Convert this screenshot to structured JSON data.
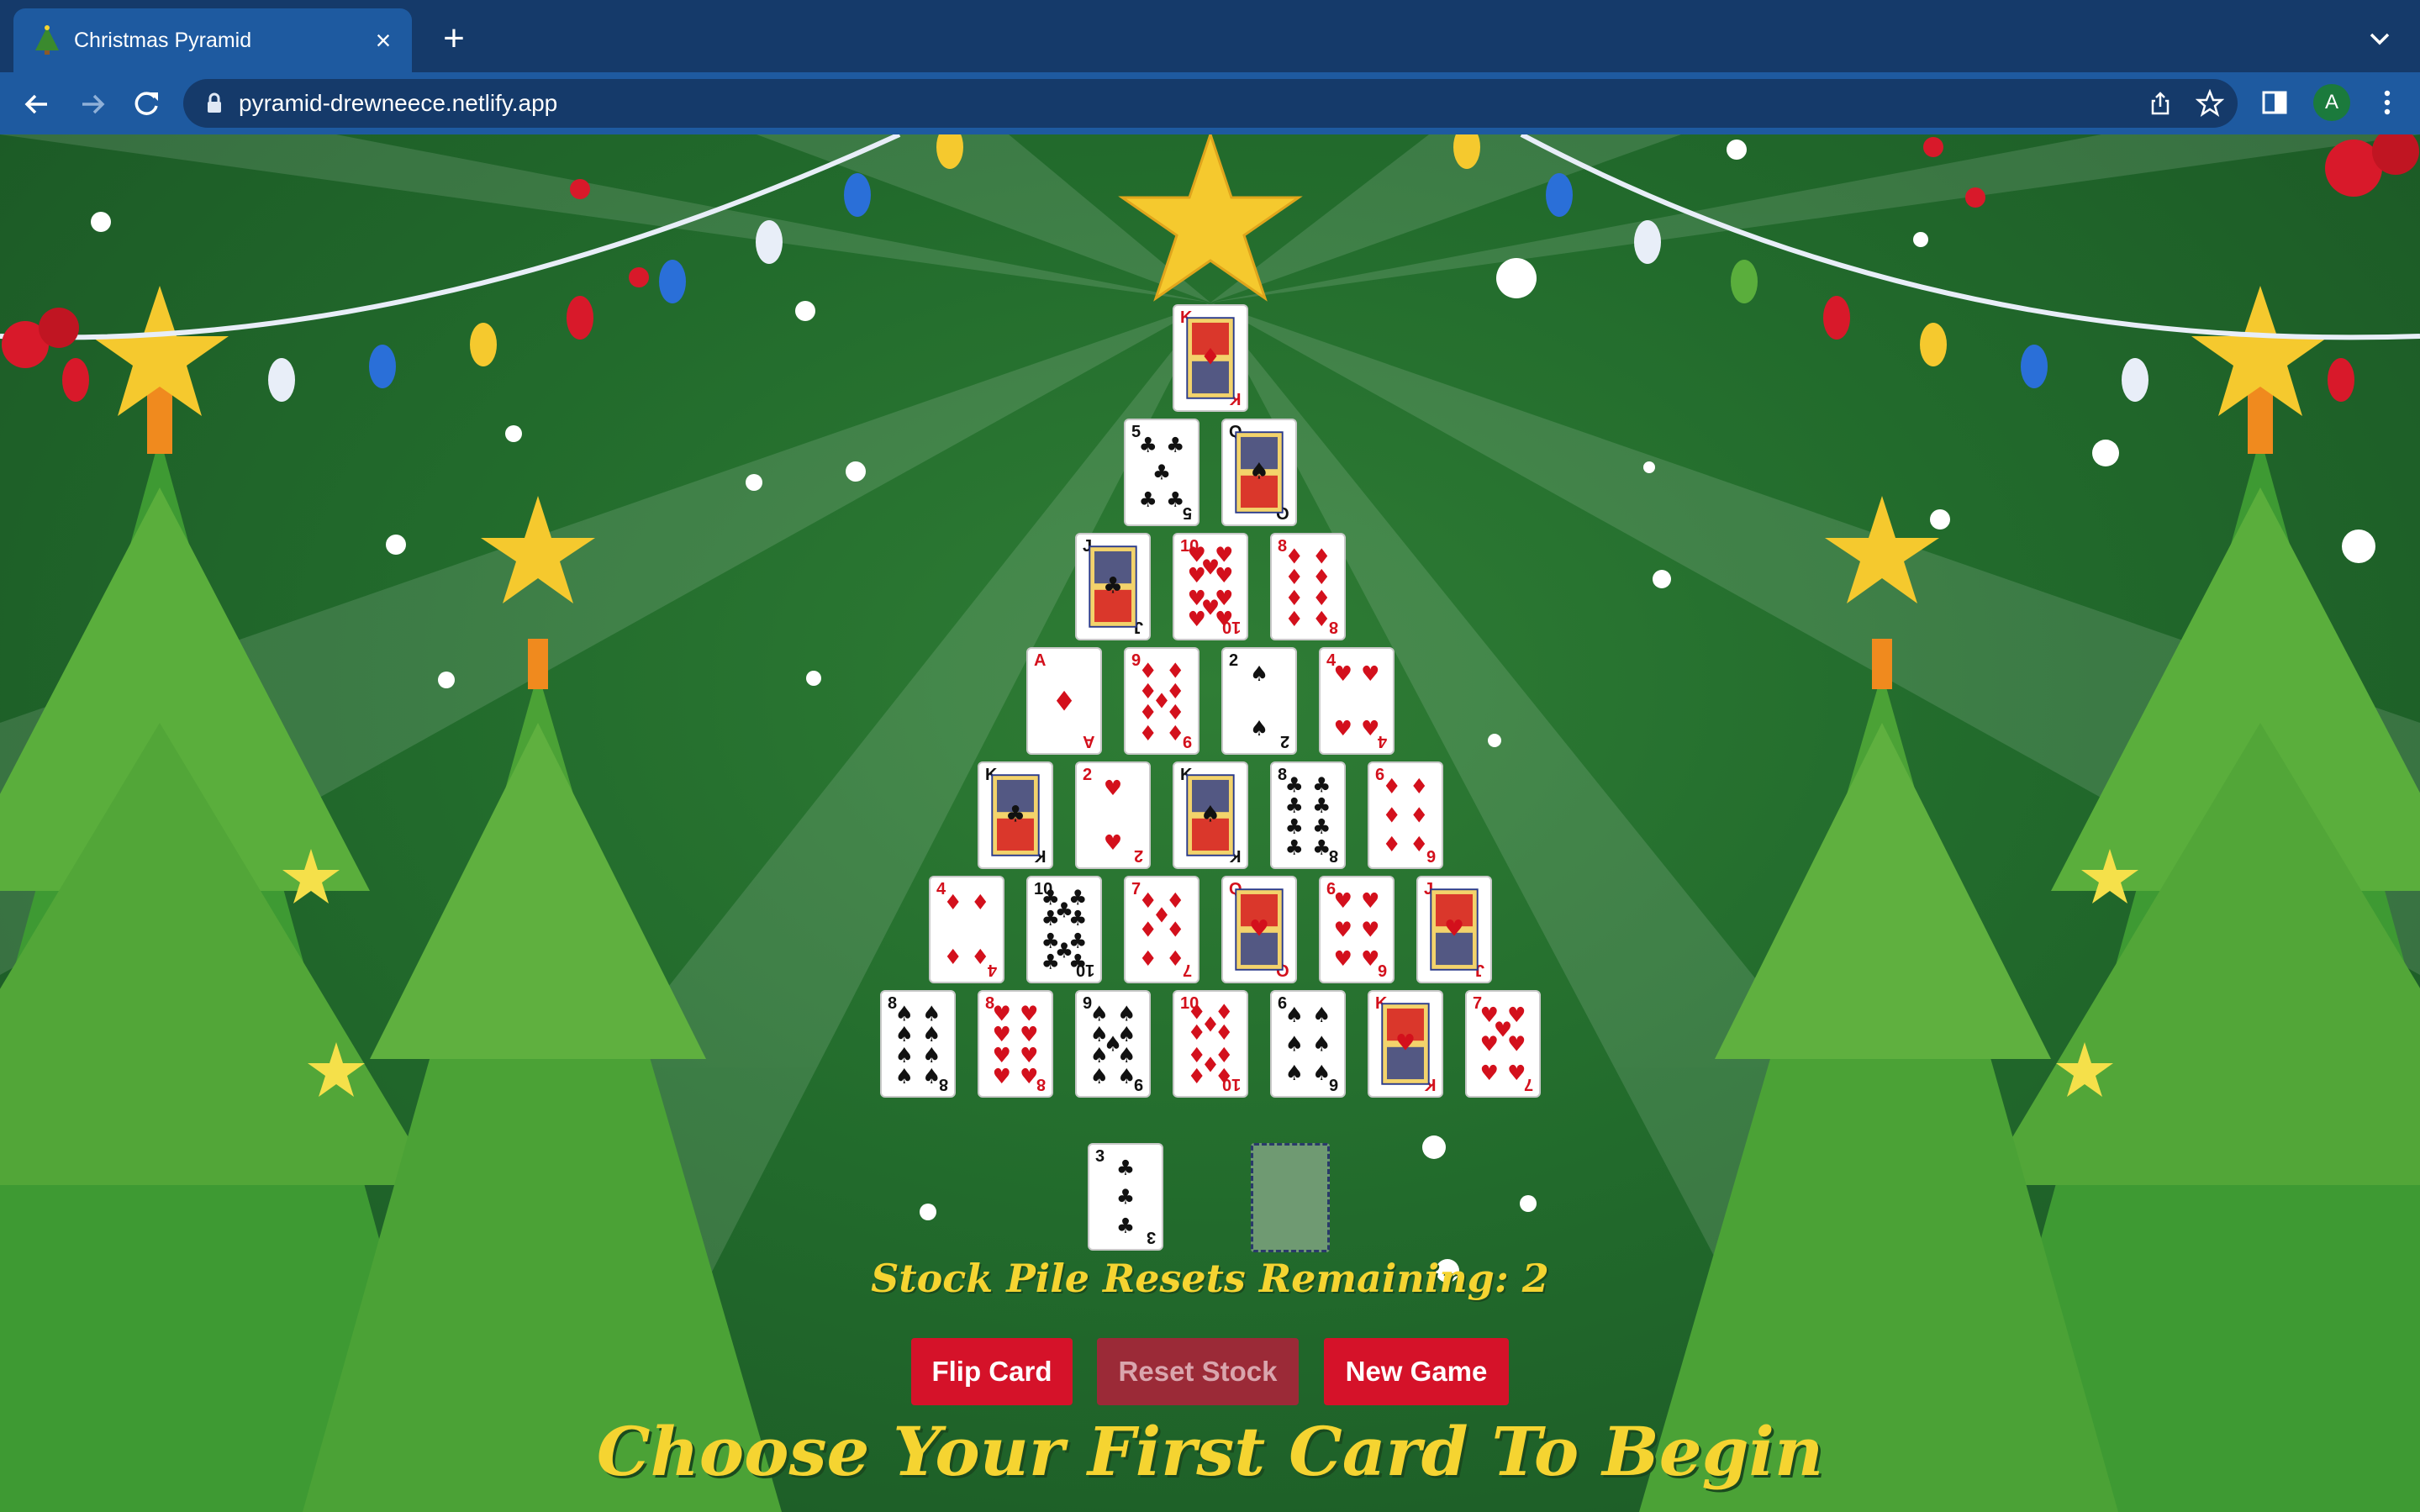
{
  "browser": {
    "tab_title": "Christmas Pyramid",
    "url": "pyramid-drewneece.netlify.app",
    "profile_initial": "A"
  },
  "colors": {
    "accent_yellow": "#f5d431",
    "button_red": "#d51229",
    "background_green": "#226b2c"
  },
  "pyramid": {
    "rows": [
      [
        {
          "rank": "K",
          "suit": "♦"
        }
      ],
      [
        {
          "rank": "5",
          "suit": "♣"
        },
        {
          "rank": "Q",
          "suit": "♠"
        }
      ],
      [
        {
          "rank": "J",
          "suit": "♣"
        },
        {
          "rank": "10",
          "suit": "♥"
        },
        {
          "rank": "8",
          "suit": "♦"
        }
      ],
      [
        {
          "rank": "A",
          "suit": "♦"
        },
        {
          "rank": "9",
          "suit": "♦"
        },
        {
          "rank": "2",
          "suit": "♠"
        },
        {
          "rank": "4",
          "suit": "♥"
        }
      ],
      [
        {
          "rank": "K",
          "suit": "♣"
        },
        {
          "rank": "2",
          "suit": "♥"
        },
        {
          "rank": "K",
          "suit": "♠"
        },
        {
          "rank": "8",
          "suit": "♣"
        },
        {
          "rank": "6",
          "suit": "♦"
        }
      ],
      [
        {
          "rank": "4",
          "suit": "♦"
        },
        {
          "rank": "10",
          "suit": "♣"
        },
        {
          "rank": "7",
          "suit": "♦"
        },
        {
          "rank": "Q",
          "suit": "♥"
        },
        {
          "rank": "6",
          "suit": "♥"
        },
        {
          "rank": "J",
          "suit": "♥"
        }
      ],
      [
        {
          "rank": "8",
          "suit": "♠"
        },
        {
          "rank": "8",
          "suit": "♥"
        },
        {
          "rank": "9",
          "suit": "♠"
        },
        {
          "rank": "10",
          "suit": "♦"
        },
        {
          "rank": "6",
          "suit": "♠"
        },
        {
          "rank": "K",
          "suit": "♥"
        },
        {
          "rank": "7",
          "suit": "♥"
        }
      ]
    ]
  },
  "stock_card": {
    "rank": "3",
    "suit": "♣"
  },
  "resets_text": "Stock Pile Resets Remaining: 2",
  "buttons": {
    "flip": "Flip Card",
    "reset": "Reset Stock",
    "new_game": "New Game"
  },
  "headline": "Choose Your First Card To Begin"
}
